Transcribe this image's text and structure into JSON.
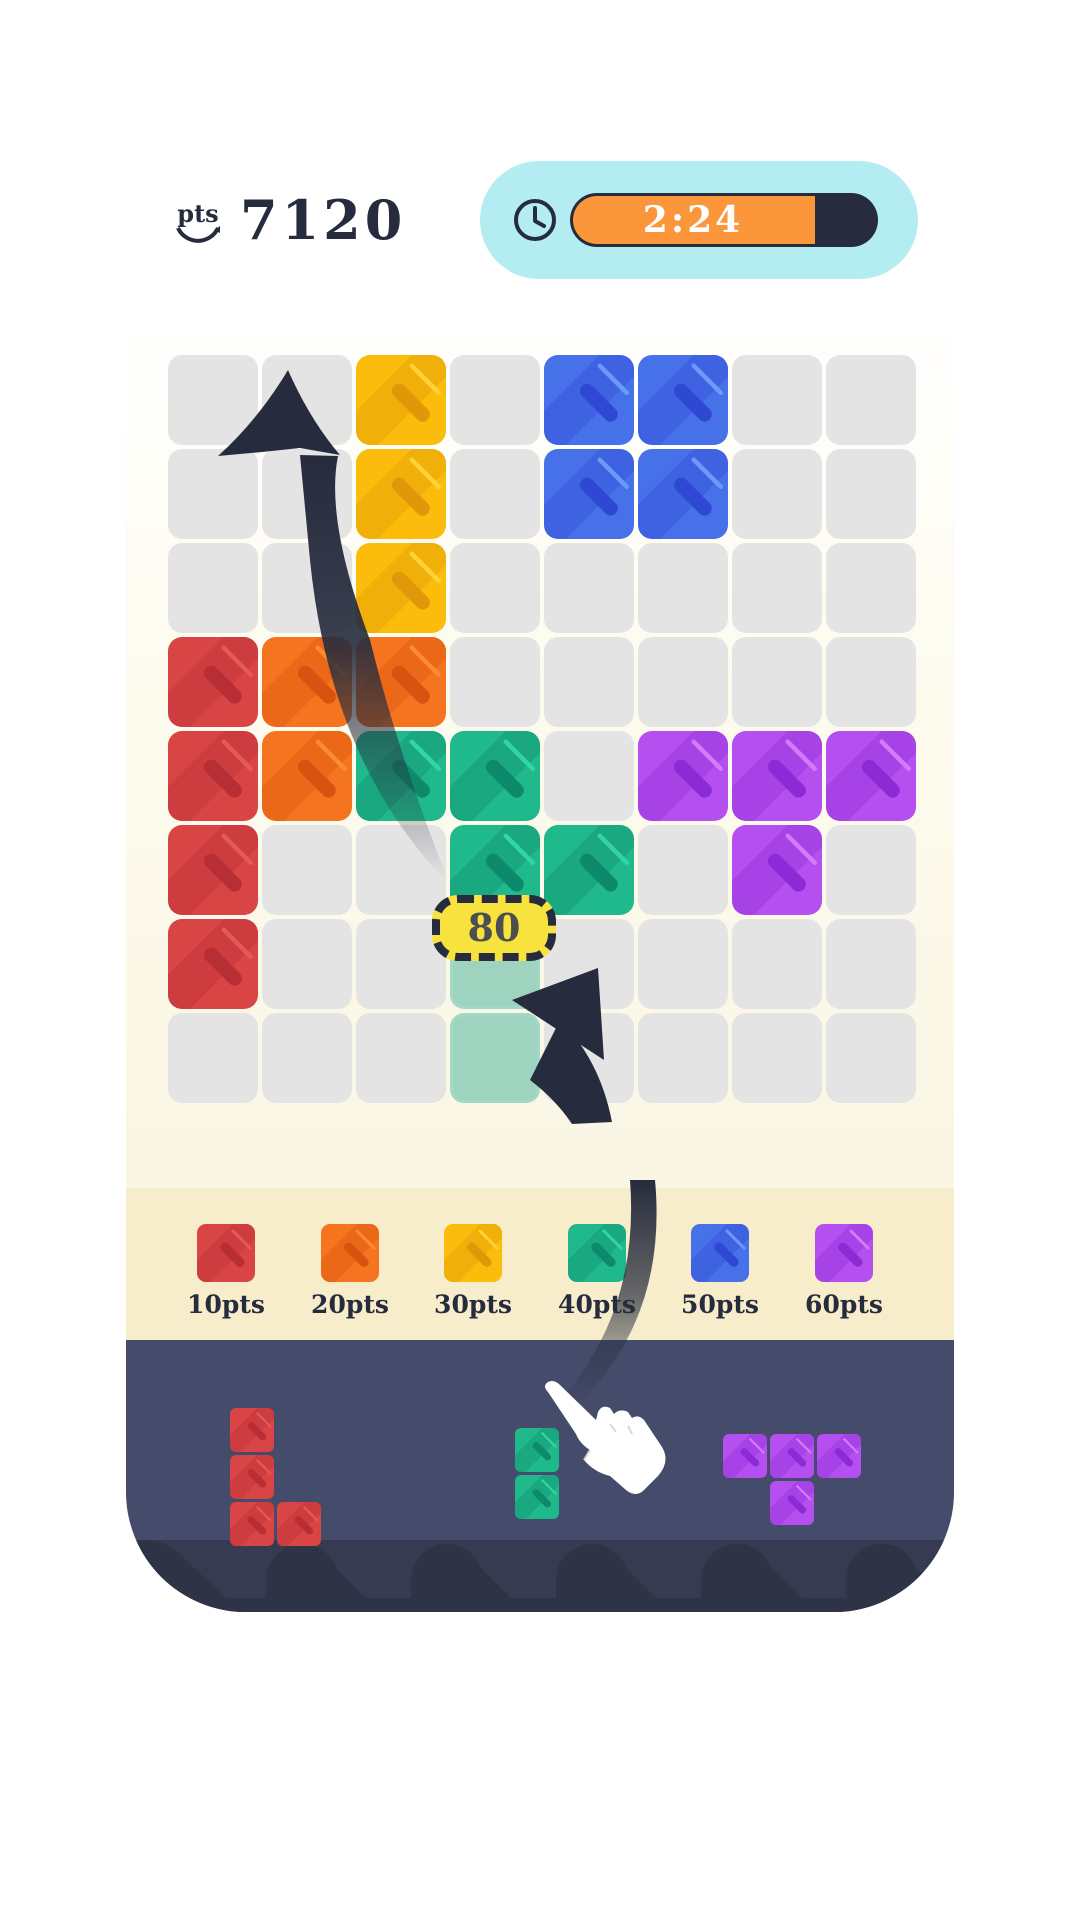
{
  "header": {
    "score_icon": "pts-coin-icon",
    "score_icon_text": "pts",
    "score": "7120",
    "timer_icon": "clock-icon",
    "timer_text": "2:24",
    "timer_remaining_fraction": 0.8,
    "colors": {
      "pill": "#b3ecf1",
      "bar_fill": "#fb963b",
      "bar_track": "#262c3d"
    }
  },
  "palette": {
    "red": {
      "base": "#d94444",
      "light": "#e35a5a",
      "dark": "#b82e35"
    },
    "orange": {
      "base": "#f57420",
      "light": "#fb8d30",
      "dark": "#d9520f"
    },
    "yellow": {
      "base": "#fbbc0b",
      "light": "#ffd23a",
      "dark": "#e0980a"
    },
    "green": {
      "base": "#20b98b",
      "light": "#33d6a3",
      "dark": "#0d8a6c"
    },
    "blue": {
      "base": "#4771e8",
      "light": "#6b9bf7",
      "dark": "#2f48d4"
    },
    "purple": {
      "base": "#b54ff0",
      "light": "#d27cf9",
      "dark": "#8c2bd6"
    }
  },
  "board": {
    "rows": 8,
    "cols": 8,
    "grid": [
      [
        "",
        "",
        "yellow",
        "",
        "blue",
        "blue",
        "",
        ""
      ],
      [
        "",
        "",
        "yellow",
        "",
        "blue",
        "blue",
        "",
        ""
      ],
      [
        "",
        "",
        "yellow",
        "",
        "",
        "",
        "",
        ""
      ],
      [
        "red",
        "orange",
        "orange",
        "",
        "",
        "",
        "",
        ""
      ],
      [
        "red",
        "orange",
        "green",
        "green",
        "",
        "purple",
        "purple",
        "purple"
      ],
      [
        "red",
        "",
        "",
        "green",
        "green",
        "",
        "purple",
        ""
      ],
      [
        "red",
        "",
        "",
        "",
        "",
        "",
        "",
        ""
      ],
      [
        "",
        "",
        "",
        "",
        "",
        "",
        "",
        ""
      ]
    ],
    "ghost_cells": [
      [
        6,
        3
      ],
      [
        7,
        3
      ]
    ],
    "points_popup": "80"
  },
  "legend": [
    {
      "color": "red",
      "label": "10pts"
    },
    {
      "color": "orange",
      "label": "20pts"
    },
    {
      "color": "yellow",
      "label": "30pts"
    },
    {
      "color": "green",
      "label": "40pts"
    },
    {
      "color": "blue",
      "label": "50pts"
    },
    {
      "color": "purple",
      "label": "60pts"
    }
  ],
  "tray": {
    "pieces": [
      {
        "name": "tray-piece-red-l",
        "color": "red",
        "cells": [
          [
            0,
            0
          ],
          [
            1,
            0
          ],
          [
            2,
            0
          ],
          [
            2,
            1
          ]
        ]
      },
      {
        "name": "tray-piece-green-bar",
        "color": "green",
        "cells": [
          [
            0,
            0
          ],
          [
            1,
            0
          ]
        ]
      },
      {
        "name": "tray-piece-purple-t",
        "color": "purple",
        "cells": [
          [
            0,
            0
          ],
          [
            0,
            1
          ],
          [
            0,
            2
          ],
          [
            1,
            1
          ]
        ]
      }
    ],
    "pointer_icon": "pointing-hand-icon"
  }
}
